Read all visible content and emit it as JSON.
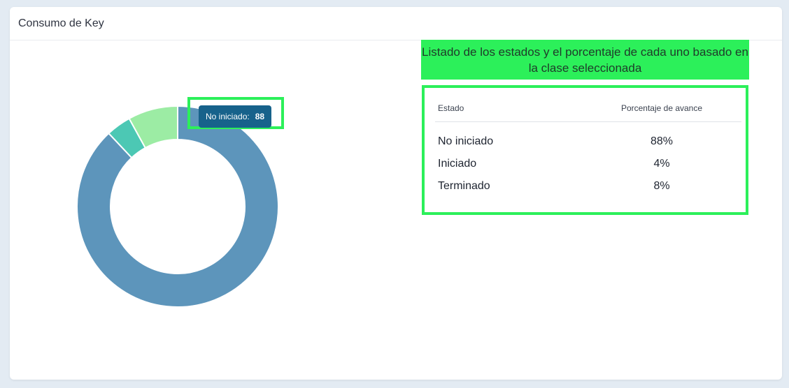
{
  "card": {
    "title": "Consumo de Key"
  },
  "tooltip": {
    "label": "No iniciado:",
    "value": "88"
  },
  "note": {
    "text": "Listado de los estados y el porcentaje de cada uno basado en la clase seleccionada"
  },
  "table": {
    "headers": {
      "estado": "Estado",
      "porcentaje": "Porcentaje de avance"
    },
    "rows": [
      {
        "estado": "No iniciado",
        "porcentaje": "88%"
      },
      {
        "estado": "Iniciado",
        "porcentaje": "4%"
      },
      {
        "estado": "Terminado",
        "porcentaje": "8%"
      }
    ]
  },
  "colors": {
    "no_iniciado": "#5d95bb",
    "iniciado": "#4cc8b4",
    "terminado": "#9ceca4",
    "highlight": "#2cf05a",
    "tooltip_bg": "#17628b"
  },
  "chart_data": {
    "type": "pie",
    "categories": [
      "No iniciado",
      "Iniciado",
      "Terminado"
    ],
    "values": [
      88,
      4,
      8
    ]
  }
}
